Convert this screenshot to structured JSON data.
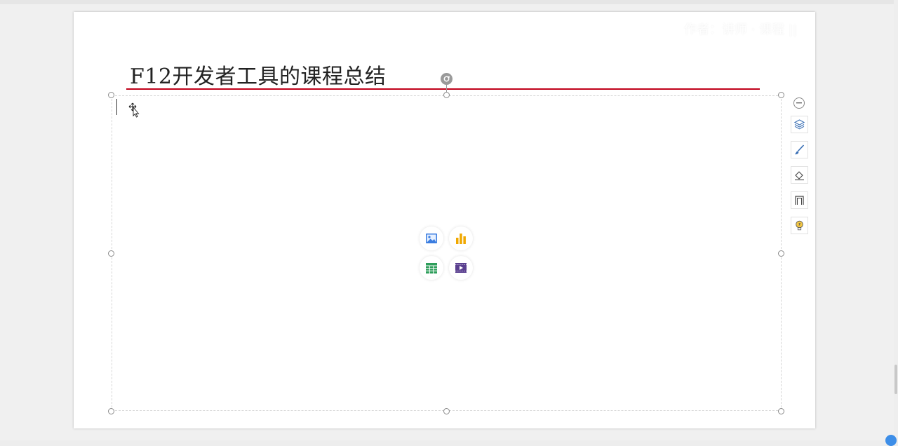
{
  "slide": {
    "title": "F12开发者工具的课程总结"
  },
  "placeholder": {
    "insert_options": [
      {
        "name": "insert-image",
        "icon": "image-icon",
        "color": "#3b7de0"
      },
      {
        "name": "insert-chart",
        "icon": "bar-chart-icon",
        "color": "#f0a800"
      },
      {
        "name": "insert-table",
        "icon": "table-icon",
        "color": "#2e9e5b"
      },
      {
        "name": "insert-video",
        "icon": "video-icon",
        "color": "#5a3f8f"
      }
    ]
  },
  "side_toolbar": {
    "items": [
      {
        "name": "collapse-toolbar",
        "icon": "minus-circle-icon"
      },
      {
        "name": "layers",
        "icon": "layers-icon"
      },
      {
        "name": "brush",
        "icon": "brush-icon"
      },
      {
        "name": "eraser-fill",
        "icon": "eraser-icon"
      },
      {
        "name": "frame",
        "icon": "frame-icon"
      },
      {
        "name": "idea",
        "icon": "lightbulb-icon"
      }
    ]
  },
  "watermark": {
    "text": "作者：讲师 · 课程 ||"
  },
  "colors": {
    "title_rule": "#c0001a",
    "slide_bg": "#ffffff",
    "workspace_bg": "#f0f0f0"
  }
}
